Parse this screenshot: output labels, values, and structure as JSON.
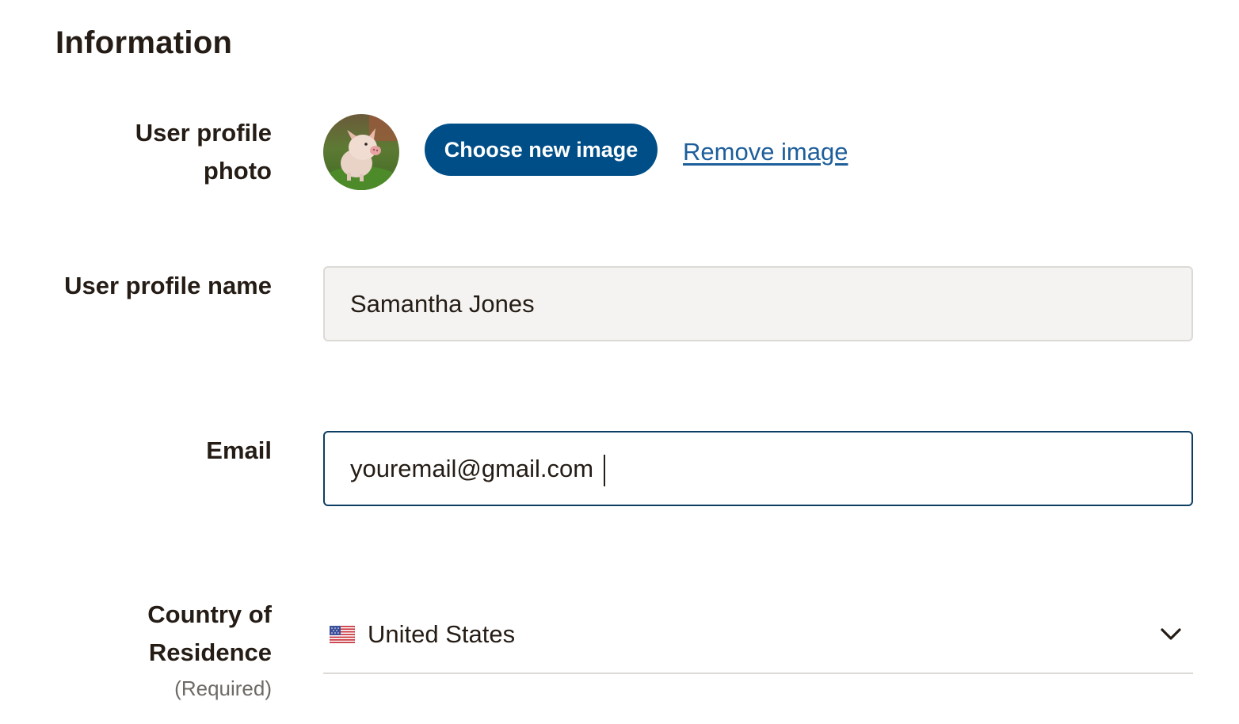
{
  "page": {
    "title": "Information"
  },
  "profile_photo": {
    "label_line1": "User profile",
    "label_line2": "photo",
    "avatar_icon": "pig-photo-avatar",
    "choose_button_label": "Choose new image",
    "remove_link_label": "Remove image"
  },
  "profile_name": {
    "label": "User profile name",
    "value": "Samantha Jones"
  },
  "email": {
    "label": "Email",
    "value": "youremail@gmail.com"
  },
  "country": {
    "label_line1": "Country of",
    "label_line2": "Residence",
    "required_note": "(Required)",
    "flag_icon": "us-flag-icon",
    "selected_value": "United States",
    "dropdown_icon": "chevron-down-icon"
  },
  "colors": {
    "primary_button": "#004e87",
    "link": "#1d5e9b",
    "text": "#241c15",
    "focused_field_border": "#0c3e63",
    "disabled_field_background": "#f4f3f1"
  }
}
